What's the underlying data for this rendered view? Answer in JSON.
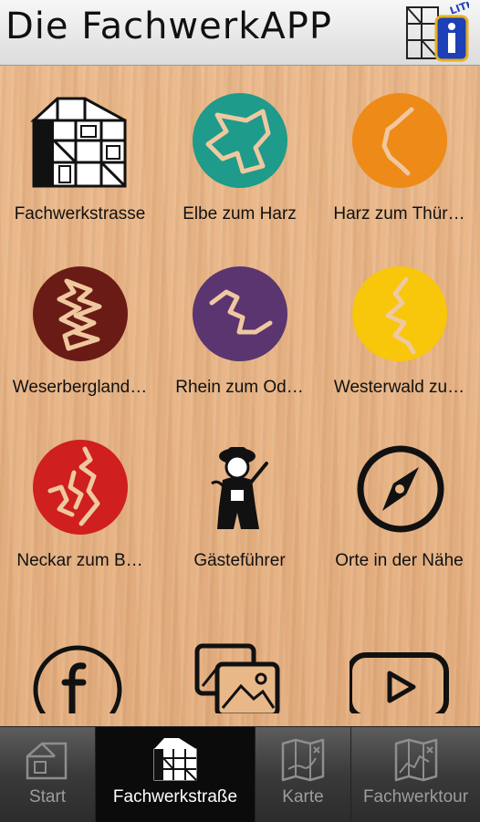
{
  "header": {
    "title": "Die FachwerkAPP",
    "badge": "LITE",
    "info_glyph": "i"
  },
  "colors": {
    "teal": "#1e9b8a",
    "orange": "#ee8a17",
    "maroon": "#6b1b15",
    "purple": "#5a3570",
    "yellow": "#f8c60a",
    "red": "#cf1f1f",
    "route_line": "#f0c8a0"
  },
  "grid": {
    "items": [
      {
        "label": "Fachwerkstrasse",
        "icon": "half-timbered-house-icon"
      },
      {
        "label": "Elbe zum Harz",
        "icon": "route-teal-icon"
      },
      {
        "label": "Harz zum Thür…",
        "icon": "route-orange-icon"
      },
      {
        "label": "Weserbergland…",
        "icon": "route-maroon-icon"
      },
      {
        "label": "Rhein zum Od…",
        "icon": "route-purple-icon"
      },
      {
        "label": "Westerwald zu…",
        "icon": "route-yellow-icon"
      },
      {
        "label": "Neckar zum B…",
        "icon": "route-red-icon"
      },
      {
        "label": "Gästeführer",
        "icon": "guide-figure-icon"
      },
      {
        "label": "Orte in der Nähe",
        "icon": "compass-icon"
      },
      {
        "label": "",
        "icon": "facebook-icon"
      },
      {
        "label": "",
        "icon": "gallery-icon"
      },
      {
        "label": "",
        "icon": "video-play-icon"
      }
    ]
  },
  "tabs": [
    {
      "label": "Start",
      "icon": "house-icon",
      "active": false
    },
    {
      "label": "Fachwerkstraße",
      "icon": "half-timbered-house-icon",
      "active": true
    },
    {
      "label": "Karte",
      "icon": "map-icon",
      "active": false
    },
    {
      "label": "Fachwerktour",
      "icon": "map-route-icon",
      "active": false
    }
  ]
}
